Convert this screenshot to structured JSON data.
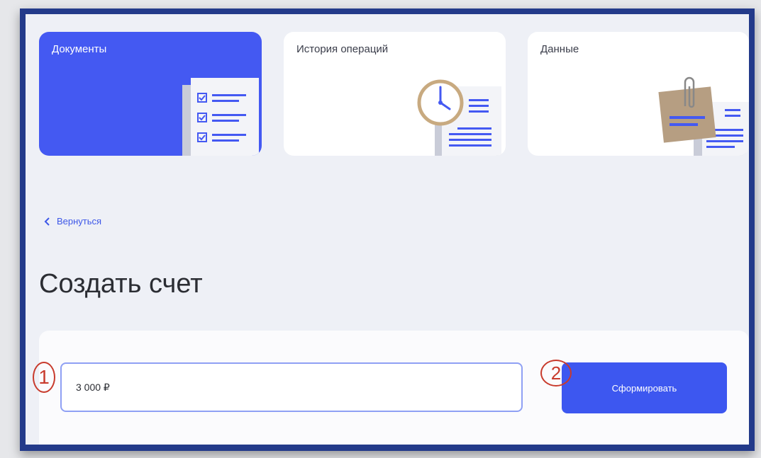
{
  "tabs": [
    {
      "label": "Документы",
      "icon": "documents-checklist-icon",
      "active": true
    },
    {
      "label": "История операций",
      "icon": "clock-document-icon",
      "active": false
    },
    {
      "label": "Данные",
      "icon": "paperclip-document-icon",
      "active": false
    }
  ],
  "nav": {
    "back_label": "Вернуться"
  },
  "page": {
    "title": "Создать счет"
  },
  "form": {
    "amount_value": "3 000 ₽",
    "submit_label": "Сформировать"
  },
  "annotations": {
    "marker_1": "1",
    "marker_2": "2"
  },
  "colors": {
    "accent": "#4459f2",
    "button": "#3d57f0",
    "link": "#3d57e8",
    "frame": "#233a8a",
    "annotation": "#c83a2c"
  }
}
